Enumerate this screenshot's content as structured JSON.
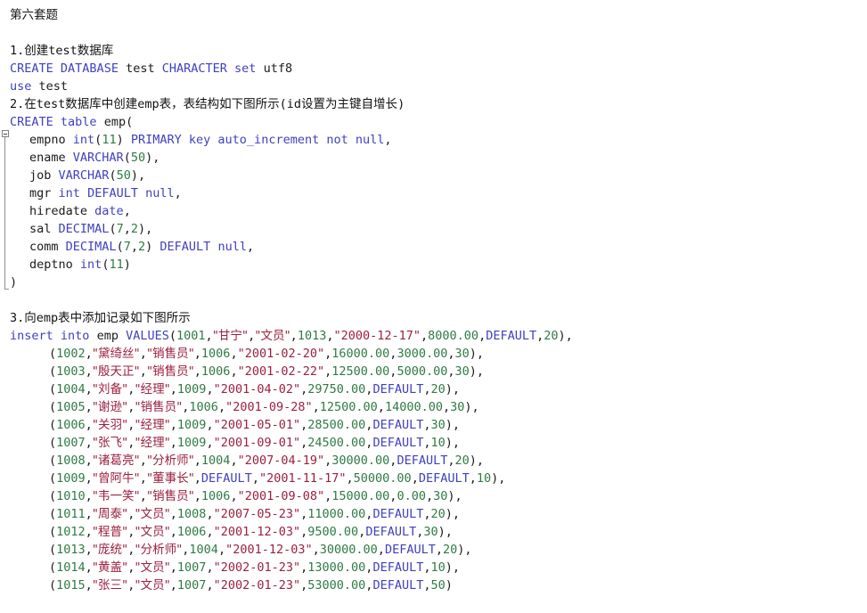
{
  "document": {
    "title": "第六套题",
    "sections": [
      {
        "heading": "1.创建test数据库",
        "statements": [
          "CREATE DATABASE test CHARACTER set utf8",
          "use test"
        ]
      },
      {
        "heading": "2.在test数据库中创建emp表，表结构如下图所示(id设置为主键自增长)",
        "statements": []
      },
      {
        "heading": "3.向emp表中添加记录如下图所示",
        "statements": []
      }
    ]
  },
  "lines": [
    {
      "id": "l1",
      "kind": "heading",
      "indent": 0,
      "text": "第六套题"
    },
    {
      "id": "l2",
      "kind": "blank",
      "indent": 0,
      "text": ""
    },
    {
      "id": "l3",
      "kind": "heading",
      "indent": 0,
      "text": "1.创建test数据库"
    },
    {
      "id": "l4",
      "kind": "sql",
      "indent": 0,
      "text": "CREATE DATABASE test CHARACTER set utf8"
    },
    {
      "id": "l5",
      "kind": "sql",
      "indent": 0,
      "text": "use test"
    },
    {
      "id": "l6",
      "kind": "heading",
      "indent": 0,
      "text": "2.在test数据库中创建emp表，表结构如下图所示(id设置为主键自增长)"
    },
    {
      "id": "l7",
      "kind": "sql",
      "indent": 0,
      "text": "CREATE table emp("
    },
    {
      "id": "l8",
      "kind": "sql",
      "indent": 1,
      "text": "empno int(11) PRIMARY key auto_increment not null,"
    },
    {
      "id": "l9",
      "kind": "sql",
      "indent": 1,
      "text": "ename VARCHAR(50),"
    },
    {
      "id": "l10",
      "kind": "sql",
      "indent": 1,
      "text": "job VARCHAR(50),"
    },
    {
      "id": "l11",
      "kind": "sql",
      "indent": 1,
      "text": "mgr int DEFAULT null,"
    },
    {
      "id": "l12",
      "kind": "sql",
      "indent": 1,
      "text": "hiredate date,"
    },
    {
      "id": "l13",
      "kind": "sql",
      "indent": 1,
      "text": "sal DECIMAL(7,2),"
    },
    {
      "id": "l14",
      "kind": "sql",
      "indent": 1,
      "text": "comm DECIMAL(7,2) DEFAULT null,"
    },
    {
      "id": "l15",
      "kind": "sql",
      "indent": 1,
      "text": "deptno int(11)"
    },
    {
      "id": "l16",
      "kind": "sql",
      "indent": 0,
      "text": ")"
    },
    {
      "id": "l17",
      "kind": "blank",
      "indent": 0,
      "text": ""
    },
    {
      "id": "l18",
      "kind": "heading",
      "indent": 0,
      "text": "3.向emp表中添加记录如下图所示"
    },
    {
      "id": "l19",
      "kind": "sql",
      "indent": 0,
      "text": "insert into emp VALUES(1001,\"甘宁\",\"文员\",1013,\"2000-12-17\",8000.00,DEFAULT,20),"
    },
    {
      "id": "l20",
      "kind": "sql",
      "indent": 2,
      "text": "(1002,\"黛绮丝\",\"销售员\",1006,\"2001-02-20\",16000.00,3000.00,30),"
    },
    {
      "id": "l21",
      "kind": "sql",
      "indent": 2,
      "text": "(1003,\"殷天正\",\"销售员\",1006,\"2001-02-22\",12500.00,5000.00,30),"
    },
    {
      "id": "l22",
      "kind": "sql",
      "indent": 2,
      "text": "(1004,\"刘备\",\"经理\",1009,\"2001-04-02\",29750.00,DEFAULT,20),"
    },
    {
      "id": "l23",
      "kind": "sql",
      "indent": 2,
      "text": "(1005,\"谢逊\",\"销售员\",1006,\"2001-09-28\",12500.00,14000.00,30),"
    },
    {
      "id": "l24",
      "kind": "sql",
      "indent": 2,
      "text": "(1006,\"关羽\",\"经理\",1009,\"2001-05-01\",28500.00,DEFAULT,30),"
    },
    {
      "id": "l25",
      "kind": "sql",
      "indent": 2,
      "text": "(1007,\"张飞\",\"经理\",1009,\"2001-09-01\",24500.00,DEFAULT,10),"
    },
    {
      "id": "l26",
      "kind": "sql",
      "indent": 2,
      "text": "(1008,\"诸葛亮\",\"分析师\",1004,\"2007-04-19\",30000.00,DEFAULT,20),"
    },
    {
      "id": "l27",
      "kind": "sql",
      "indent": 2,
      "text": "(1009,\"曾阿牛\",\"董事长\",DEFAULT,\"2001-11-17\",50000.00,DEFAULT,10),"
    },
    {
      "id": "l28",
      "kind": "sql",
      "indent": 2,
      "text": "(1010,\"韦一笑\",\"销售员\",1006,\"2001-09-08\",15000.00,0.00,30),"
    },
    {
      "id": "l29",
      "kind": "sql",
      "indent": 2,
      "text": "(1011,\"周泰\",\"文员\",1008,\"2007-05-23\",11000.00,DEFAULT,20),"
    },
    {
      "id": "l30",
      "kind": "sql",
      "indent": 2,
      "text": "(1012,\"程普\",\"文员\",1006,\"2001-12-03\",9500.00,DEFAULT,30),"
    },
    {
      "id": "l31",
      "kind": "sql",
      "indent": 2,
      "text": "(1013,\"庞统\",\"分析师\",1004,\"2001-12-03\",30000.00,DEFAULT,20),"
    },
    {
      "id": "l32",
      "kind": "sql",
      "indent": 2,
      "text": "(1014,\"黄盖\",\"文员\",1007,\"2002-01-23\",13000.00,DEFAULT,10),"
    },
    {
      "id": "l33",
      "kind": "sql",
      "indent": 2,
      "text": "(1015,\"张三\",\"文员\",1007,\"2002-01-23\",53000.00,DEFAULT,50)"
    }
  ],
  "syntax": {
    "keywords": [
      "CREATE",
      "DATABASE",
      "CHARACTER",
      "set",
      "use",
      "table",
      "int",
      "PRIMARY",
      "key",
      "auto_increment",
      "not",
      "null",
      "VARCHAR",
      "DEFAULT",
      "DECIMAL",
      "date",
      "insert",
      "into",
      "VALUES"
    ],
    "colors": {
      "keyword": "#4040c0",
      "number": "#2f7a45",
      "string": "#9b2040",
      "plain": "#1a1a1a",
      "background": "#ffffff"
    }
  },
  "fold": {
    "marker_glyph": "minus-box",
    "start_line_id": "l7",
    "end_line_id": "l16"
  }
}
